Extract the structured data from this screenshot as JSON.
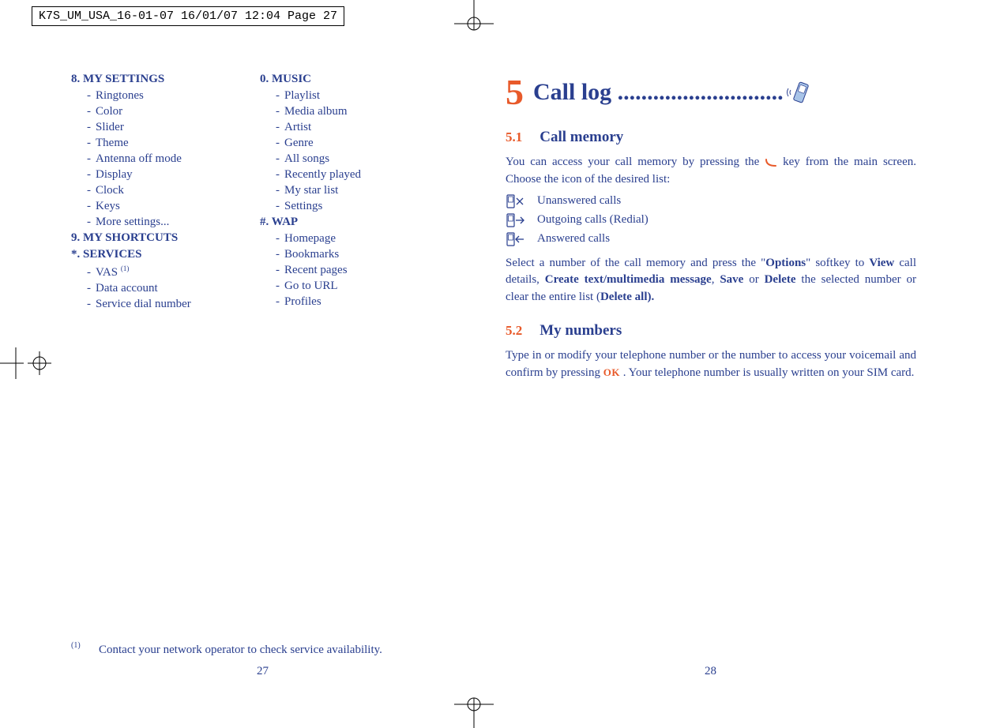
{
  "header": "K7S_UM_USA_16-01-07  16/01/07  12:04  Page 27",
  "leftCol": {
    "s8": {
      "title": "8. MY SETTINGS",
      "items": [
        "Ringtones",
        "Color",
        "Slider",
        "Theme",
        "Antenna off mode",
        "Display",
        "Clock",
        "Keys",
        "More settings..."
      ]
    },
    "s9": {
      "title": "9. MY SHORTCUTS"
    },
    "sStar": {
      "title": "*. SERVICES",
      "vas": "VAS ",
      "vasSup": "(1)",
      "items": [
        "Data account",
        "Service dial number"
      ]
    }
  },
  "rightCol": {
    "s0": {
      "title": "0. MUSIC",
      "items": [
        "Playlist",
        "Media album",
        "Artist",
        "Genre",
        "All songs",
        "Recently played",
        "My star list",
        "Settings"
      ]
    },
    "sHash": {
      "title": "#. WAP",
      "items": [
        "Homepage",
        "Bookmarks",
        "Recent pages",
        "Go to URL",
        "Profiles"
      ]
    }
  },
  "footnoteSup": "(1)",
  "footnote": "Contact your network operator to check service availability.",
  "pageNumLeft": "27",
  "pageNumRight": "28",
  "chapter": {
    "num": "5",
    "title": "Call log ............................"
  },
  "sec51": {
    "num": "5.1",
    "title": "Call memory",
    "para1a": "You can access your call memory by pressing the ",
    "para1b": " key from the main screen. Choose the icon of the desired list:",
    "calls": {
      "unanswered": "Unanswered calls",
      "outgoing": "Outgoing calls (Redial)",
      "answered": "Answered calls"
    },
    "para2a": "Select a number of the call memory and press the \"",
    "options": "Options",
    "para2b": "\" softkey to ",
    "view": "View",
    "para2c": " call details, ",
    "create": "Create text/multimedia message",
    "para2d": ", ",
    "save": "Save",
    "para2e": " or ",
    "delete": "Delete",
    "para2f": " the selected number or clear the entire list (",
    "deleteall": "Delete all).",
    "para2g": ""
  },
  "sec52": {
    "num": "5.2",
    "title": "My numbers",
    "para_a": "Type in or modify your telephone number or the number to access your voicemail and confirm by pressing ",
    "ok": "OK",
    "para_b": " . Your telephone number is usually written on your SIM card."
  }
}
